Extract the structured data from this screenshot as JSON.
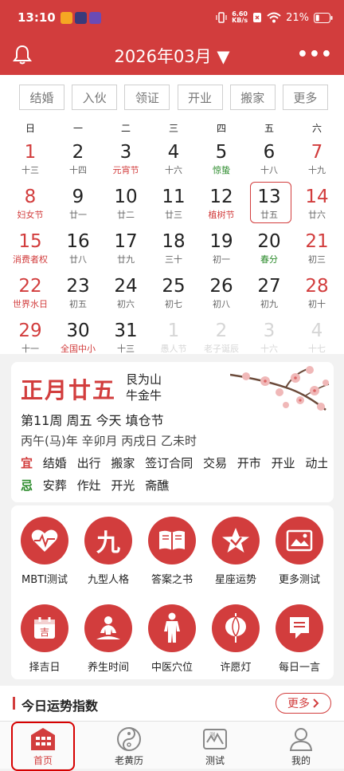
{
  "status_bar": {
    "time": "13:10",
    "net_speed": "6.60",
    "net_unit": "KB/s",
    "battery": "21%"
  },
  "header": {
    "title": "2026年03月 ▼",
    "bell_icon": "bell-icon",
    "more_icon": "more-dots-icon"
  },
  "filters": [
    "结婚",
    "入伙",
    "领证",
    "开业",
    "搬家",
    "更多"
  ],
  "weekdays": [
    "日",
    "一",
    "二",
    "三",
    "四",
    "五",
    "六"
  ],
  "calendar_rows": [
    [
      {
        "d": "1",
        "s": "十三"
      },
      {
        "d": "2",
        "s": "十四"
      },
      {
        "d": "3",
        "s": "元宵节"
      },
      {
        "d": "4",
        "s": "十六"
      },
      {
        "d": "5",
        "s": "惊蛰"
      },
      {
        "d": "6",
        "s": "十八"
      },
      {
        "d": "7",
        "s": "十九"
      }
    ],
    [
      {
        "d": "8",
        "s": "妇女节"
      },
      {
        "d": "9",
        "s": "廿一"
      },
      {
        "d": "10",
        "s": "廿二"
      },
      {
        "d": "11",
        "s": "廿三"
      },
      {
        "d": "12",
        "s": "植树节"
      },
      {
        "d": "13",
        "s": "廿五"
      },
      {
        "d": "14",
        "s": "廿六"
      }
    ],
    [
      {
        "d": "15",
        "s": "消费者权"
      },
      {
        "d": "16",
        "s": "廿八"
      },
      {
        "d": "17",
        "s": "廿九"
      },
      {
        "d": "18",
        "s": "三十"
      },
      {
        "d": "19",
        "s": "初一"
      },
      {
        "d": "20",
        "s": "春分"
      },
      {
        "d": "21",
        "s": "初三"
      }
    ],
    [
      {
        "d": "22",
        "s": "世界水日"
      },
      {
        "d": "23",
        "s": "初五"
      },
      {
        "d": "24",
        "s": "初六"
      },
      {
        "d": "25",
        "s": "初七"
      },
      {
        "d": "26",
        "s": "初八"
      },
      {
        "d": "27",
        "s": "初九"
      },
      {
        "d": "28",
        "s": "初十"
      }
    ],
    [
      {
        "d": "29",
        "s": "十一"
      },
      {
        "d": "30",
        "s": "全国中小"
      },
      {
        "d": "31",
        "s": "十三"
      },
      {
        "d": "1",
        "s": "愚人节"
      },
      {
        "d": "2",
        "s": "老子诞辰"
      },
      {
        "d": "3",
        "s": "十六"
      },
      {
        "d": "4",
        "s": "十七"
      }
    ]
  ],
  "selected_day": "13",
  "day_card": {
    "lunar_date": "正月廿五",
    "gua_1": "艮为山",
    "gua_2": "牛金牛",
    "week_line": "第11周 周五 今天  填仓节",
    "ganzhi_line": "丙午(马)年 辛卯月 丙戌日 乙未时",
    "yi_label": "宜",
    "yi_items": [
      "结婚",
      "出行",
      "搬家",
      "签订合同",
      "交易",
      "开市",
      "开业",
      "动土…"
    ],
    "ji_label": "忌",
    "ji_items": [
      "安葬",
      "作灶",
      "开光",
      "斋醮"
    ]
  },
  "tools": [
    {
      "label": "MBTI测试",
      "icon": "heart-pulse-icon"
    },
    {
      "label": "九型人格",
      "icon": "nine-icon"
    },
    {
      "label": "答案之书",
      "icon": "book-icon"
    },
    {
      "label": "星座运势",
      "icon": "star-icon"
    },
    {
      "label": "更多测试",
      "icon": "picture-icon"
    },
    {
      "label": "择吉日",
      "icon": "calendar-icon"
    },
    {
      "label": "养生时间",
      "icon": "meditation-icon"
    },
    {
      "label": "中医穴位",
      "icon": "body-icon"
    },
    {
      "label": "许愿灯",
      "icon": "lantern-icon"
    },
    {
      "label": "每日一言",
      "icon": "note-icon"
    }
  ],
  "section": {
    "title": "今日运势指数",
    "more": "更多"
  },
  "tabs": [
    {
      "label": "首页",
      "icon": "home-icon",
      "active": true
    },
    {
      "label": "老黄历",
      "icon": "yinyang-icon",
      "active": false
    },
    {
      "label": "测试",
      "icon": "test-icon",
      "active": false
    },
    {
      "label": "我的",
      "icon": "user-icon",
      "active": false
    }
  ],
  "colors": {
    "accent": "#d23d3d",
    "green": "#2a8a2a"
  }
}
